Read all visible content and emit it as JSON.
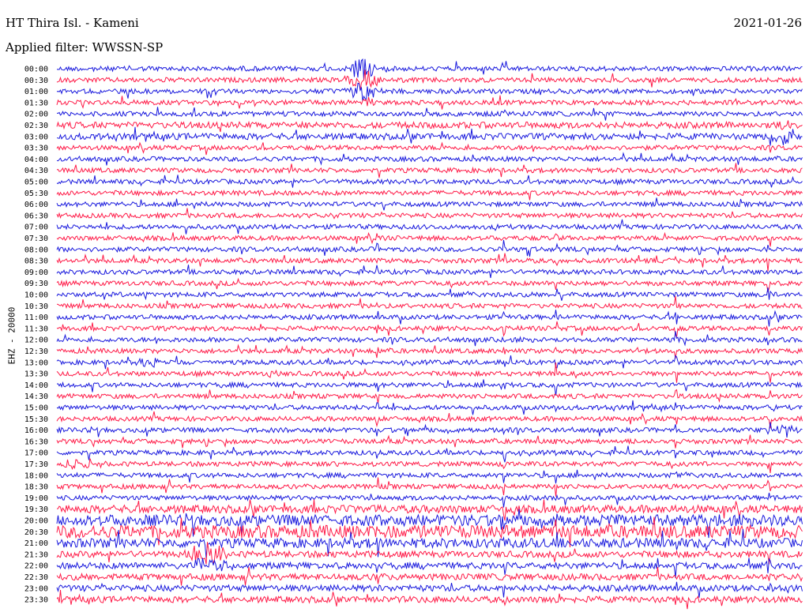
{
  "header": {
    "station": "HT Thira Isl. - Kameni",
    "filter": "Applied filter: WWSSN-SP",
    "date": "2021-01-26"
  },
  "chart_data": {
    "type": "line",
    "title": "HT Thira Isl. - Kameni",
    "subtitle": "Applied filter: WWSSN-SP",
    "date": "2021-01-26",
    "ylabel": "EHZ - 20000",
    "xlabel": "",
    "grid": false,
    "rows": [
      "00:00",
      "00:30",
      "01:00",
      "01:30",
      "02:00",
      "02:30",
      "03:00",
      "03:30",
      "04:00",
      "04:30",
      "05:00",
      "05:30",
      "06:00",
      "06:30",
      "07:00",
      "07:30",
      "08:00",
      "08:30",
      "09:00",
      "09:30",
      "10:00",
      "10:30",
      "11:00",
      "11:30",
      "12:00",
      "12:30",
      "13:00",
      "13:30",
      "14:00",
      "14:30",
      "15:00",
      "15:30",
      "16:00",
      "16:30",
      "17:00",
      "17:30",
      "18:00",
      "18:30",
      "19:00",
      "19:30",
      "20:00",
      "20:30",
      "21:00",
      "21:30",
      "22:00",
      "22:30",
      "23:00",
      "23:30"
    ],
    "colors": {
      "even_row": "#1818dd",
      "odd_row": "#ff1a47",
      "text": "#000000",
      "background": "#ffffff"
    },
    "row_noise_amplitude": [
      3,
      3,
      3,
      3,
      3,
      4,
      4,
      3,
      3,
      3,
      3,
      3,
      3,
      3,
      3,
      3,
      3,
      3,
      3,
      3,
      3,
      3,
      3,
      3,
      3,
      3,
      3,
      3,
      3,
      3,
      3,
      3,
      3,
      3,
      3,
      3,
      3,
      3,
      3,
      5,
      7,
      8,
      6,
      4,
      4,
      4,
      4,
      4
    ]
  }
}
